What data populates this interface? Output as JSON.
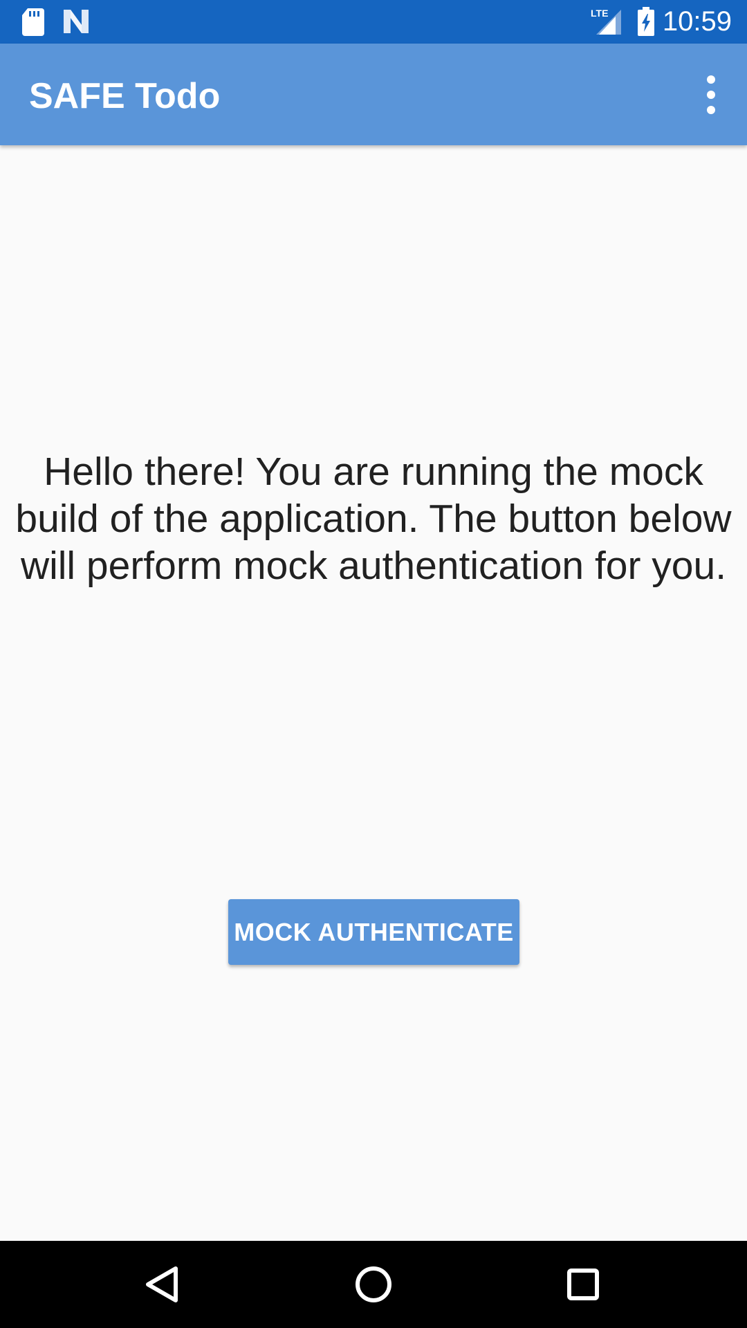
{
  "status_bar": {
    "time": "10:59",
    "network": "LTE",
    "icons": [
      "sd-card-icon",
      "notification-n-icon",
      "lte-signal-icon",
      "battery-charging-icon"
    ]
  },
  "app_bar": {
    "title": "SAFE Todo",
    "menu_icon": "more-vert-icon"
  },
  "content": {
    "message": "Hello there! You are running the mock build of the application. The button below will perform mock authentication for you.",
    "button_label": "MOCK AUTHENTICATE"
  },
  "nav_bar": {
    "icons": [
      "back-icon",
      "home-icon",
      "recents-icon"
    ]
  },
  "colors": {
    "status_bar": "#1565c0",
    "primary": "#5a95d9",
    "background": "#fafafa",
    "text": "#212121"
  }
}
